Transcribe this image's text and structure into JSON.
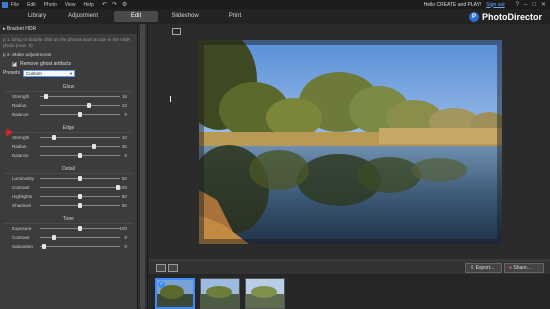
{
  "menu": {
    "items": [
      "File",
      "Edit",
      "Photo",
      "View",
      "Help"
    ],
    "greeting": "Hello CREATE and PLAY!",
    "sign_out": "Sign out"
  },
  "tabs": [
    {
      "label": "Library"
    },
    {
      "label": "Adjustment"
    },
    {
      "label": "Edit"
    },
    {
      "label": "Slideshow"
    },
    {
      "label": "Print"
    }
  ],
  "active_tab": "Edit",
  "brand": {
    "name": "PhotoDirector",
    "logo_letter": "P",
    "accent": "#2d6fd6"
  },
  "panel": {
    "title": "Bracket HDR",
    "step1": "p 1. Drag or double click on the photos want to use in the HDR photo (max. 5)",
    "step2": "p 2. Make adjustments",
    "remove_ghost_label": "Remove ghost artifacts",
    "remove_ghost_checked": true,
    "presets_label": "Presets",
    "presets_value": "Custom",
    "sections": [
      {
        "title": "Glow",
        "sliders": [
          {
            "label": "Strength",
            "value": "16",
            "pos": 0.08
          },
          {
            "label": "Radius",
            "value": "22",
            "pos": 0.61
          },
          {
            "label": "Balance",
            "value": "0",
            "pos": 0.5
          }
        ]
      },
      {
        "title": "Edge",
        "sliders": [
          {
            "label": "Strength",
            "value": "10",
            "pos": 0.18
          },
          {
            "label": "Radius",
            "value": "35",
            "pos": 0.67
          },
          {
            "label": "Balance",
            "value": "0",
            "pos": 0.5
          }
        ]
      },
      {
        "title": "Detail",
        "sliders": [
          {
            "label": "Luminosity",
            "value": "50",
            "pos": 0.5
          },
          {
            "label": "Contrast",
            "value": "100",
            "pos": 0.98
          },
          {
            "label": "Highlights",
            "value": "50",
            "pos": 0.5
          },
          {
            "label": "Shadows",
            "value": "50",
            "pos": 0.5
          }
        ]
      },
      {
        "title": "Tone",
        "sliders": [
          {
            "label": "Exposure",
            "value": "100",
            "pos": 0.5
          },
          {
            "label": "Contrast",
            "value": "0",
            "pos": 0.18
          },
          {
            "label": "Saturation",
            "value": "0",
            "pos": 0.05
          }
        ]
      }
    ]
  },
  "bottom": {
    "export_label": "Export...",
    "share_label": "Share..."
  },
  "thumbnails": [
    {
      "selected": true
    },
    {
      "selected": false
    },
    {
      "selected": false
    }
  ]
}
